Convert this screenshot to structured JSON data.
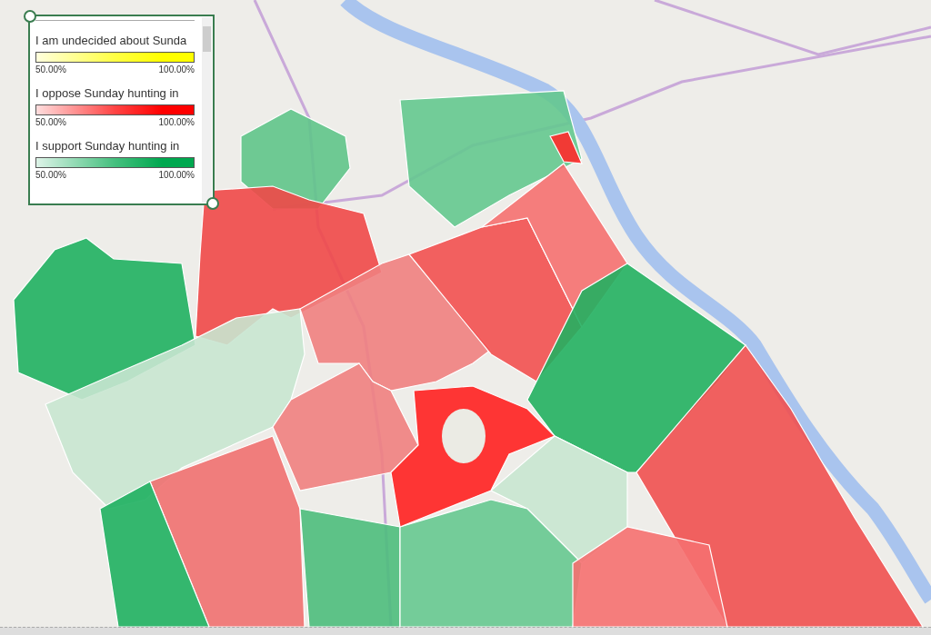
{
  "legend": {
    "items": [
      {
        "title": "I am undecided about Sunda",
        "min_label": "50.00%",
        "max_label": "100.00%",
        "color": "#ffff00"
      },
      {
        "title": "I oppose Sunday hunting in",
        "min_label": "50.00%",
        "max_label": "100.00%",
        "color": "#ff0000"
      },
      {
        "title": "I support Sunday hunting in",
        "min_label": "50.00%",
        "max_label": "100.00%",
        "color": "#00a84f"
      }
    ]
  }
}
